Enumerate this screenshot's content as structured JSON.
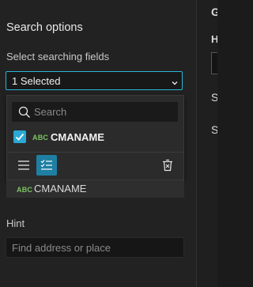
{
  "search_options": {
    "title": "Search options",
    "fields_label": "Select searching fields",
    "selected_value": "1 Selected",
    "popup": {
      "search_placeholder": "Search",
      "options": [
        {
          "type_tag": "ABC",
          "label": "CMANAME",
          "checked": true
        }
      ],
      "icons": [
        "list-icon",
        "show-selected-icon",
        "clear-selection-icon"
      ]
    },
    "selected_items": [
      {
        "type_tag": "ABC",
        "label": "CMANAME"
      }
    ],
    "hint_label": "Hint",
    "hint_placeholder": "Find address or place"
  },
  "right_panel": {
    "heading_initial": "G",
    "label_initial": "H",
    "item1_initial": "S",
    "item2_initial": "S"
  },
  "colors": {
    "accent": "#2bb5d6",
    "selected_button": "#1e7fa3",
    "field_type_tag": "#7cc462",
    "panel_bg": "#222222"
  }
}
